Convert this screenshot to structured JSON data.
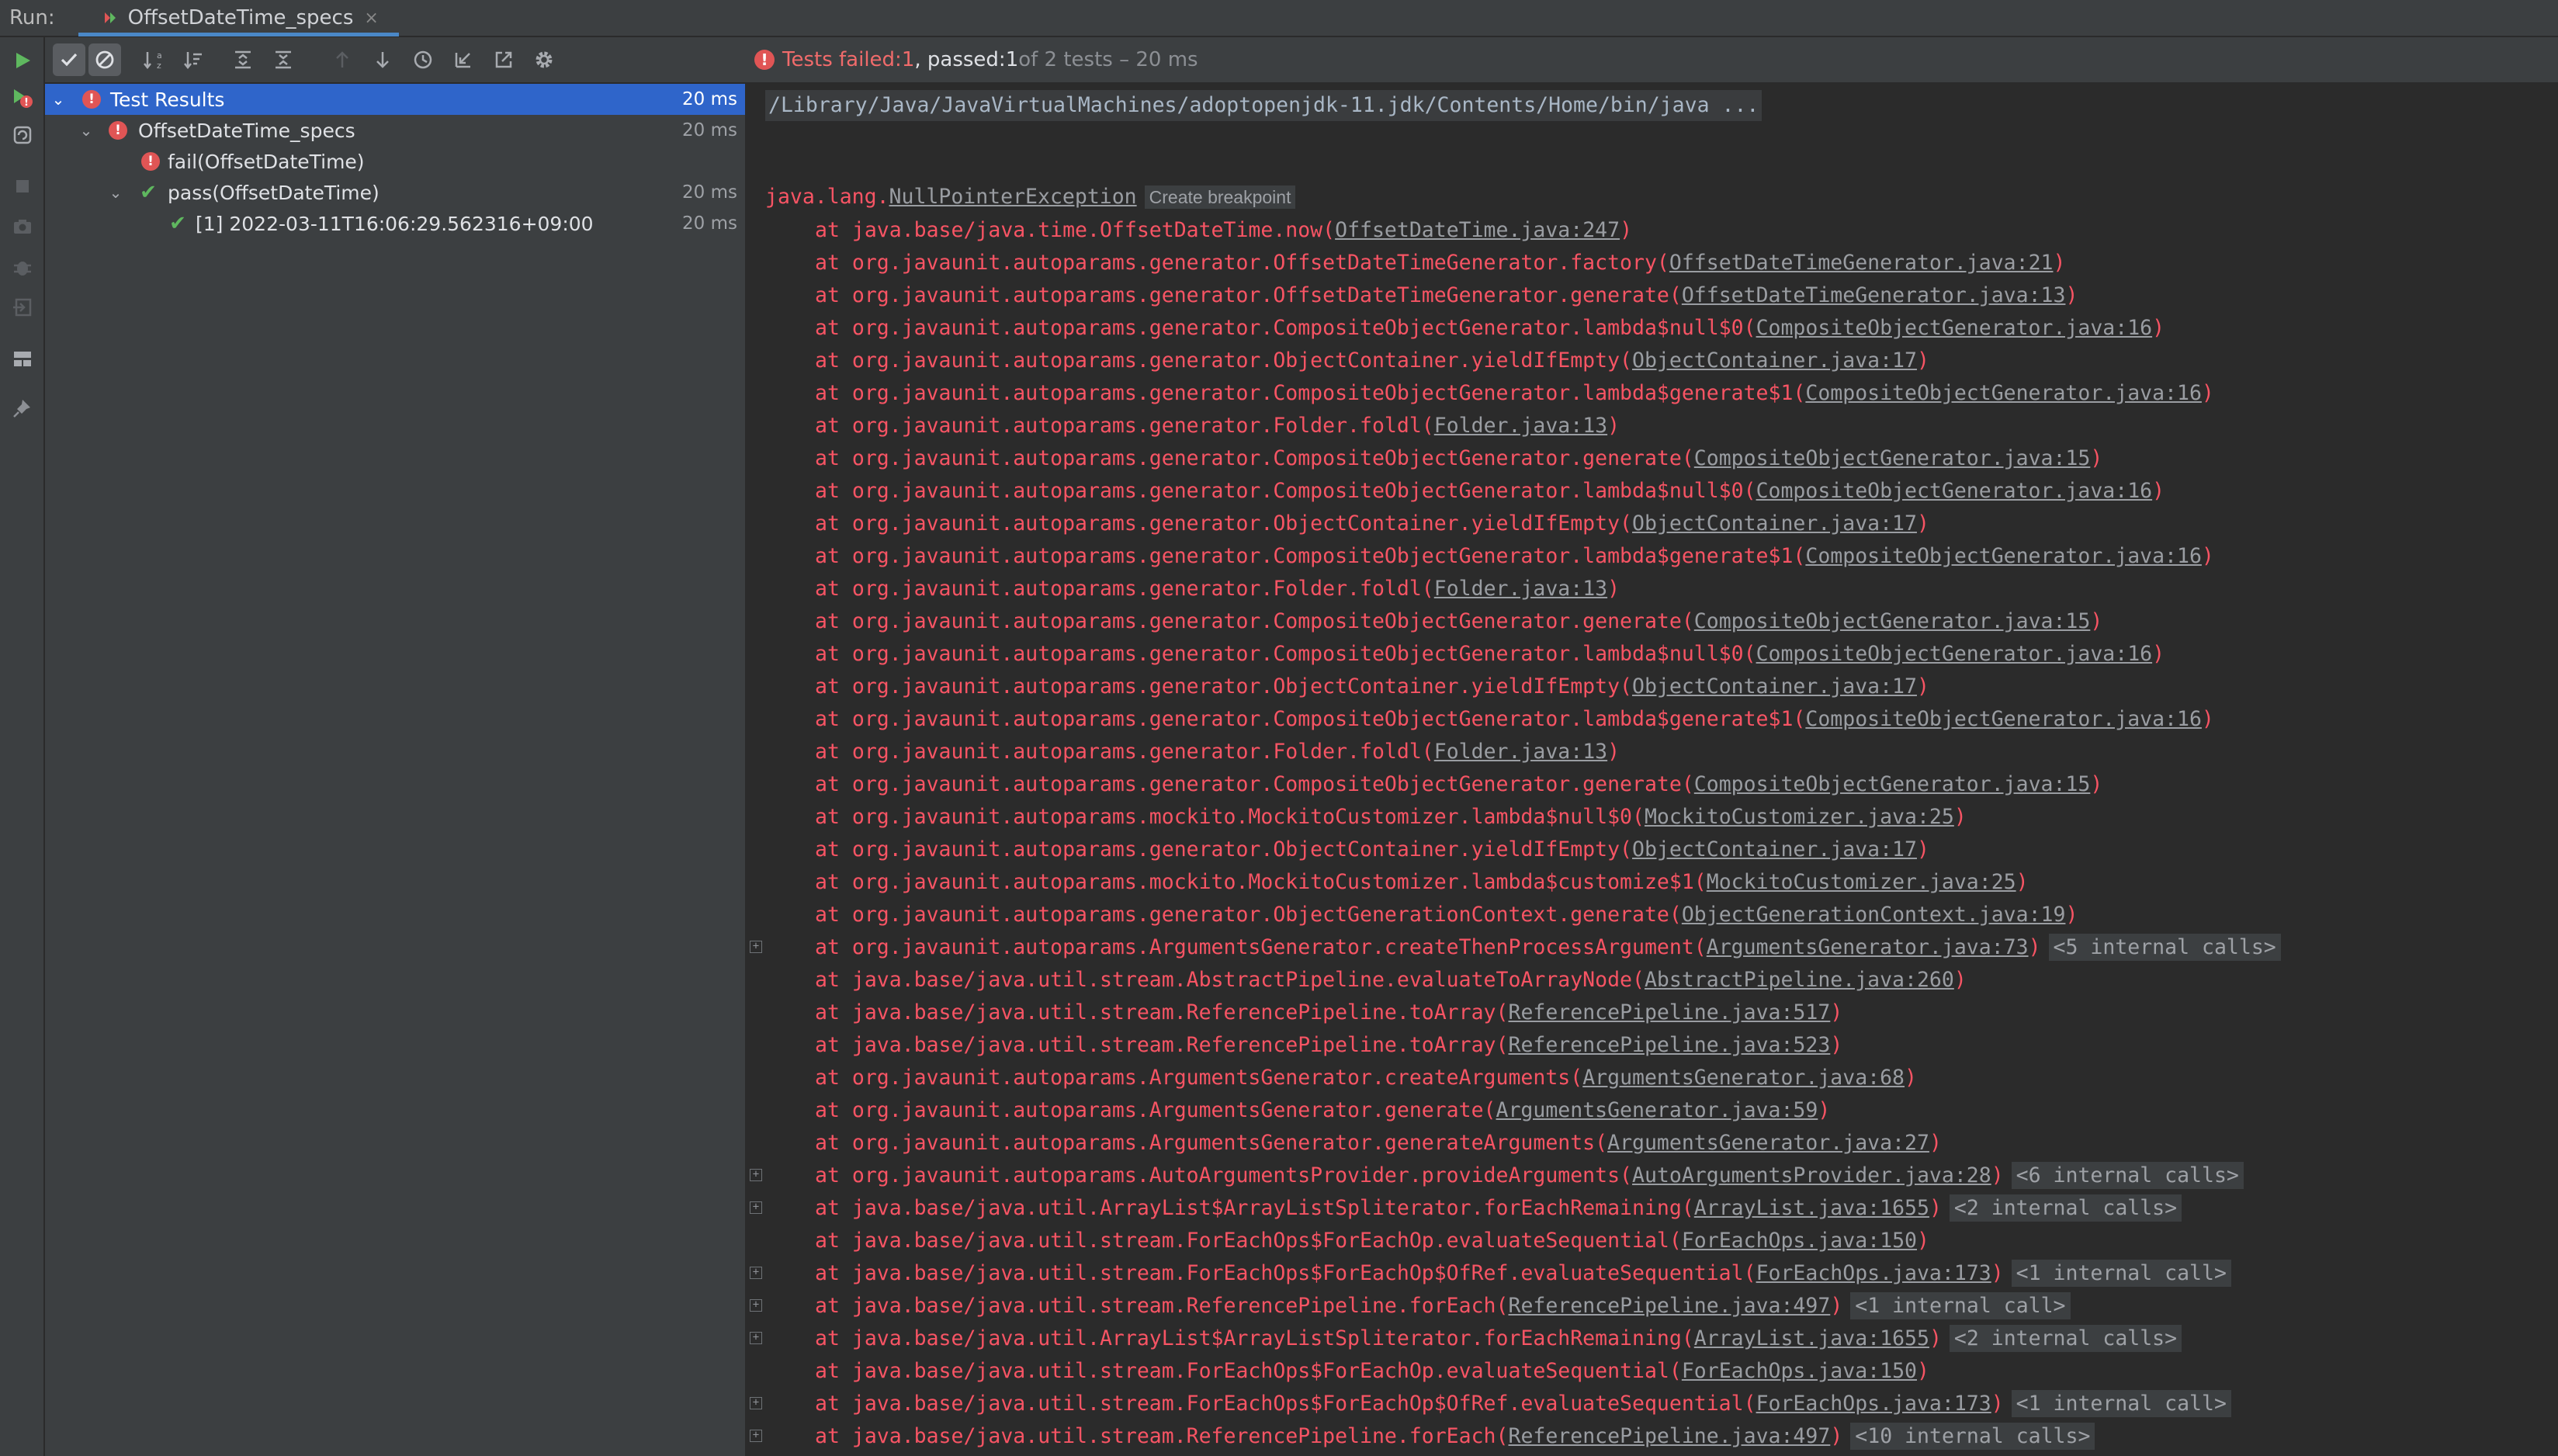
{
  "tabbar": {
    "run_label": "Run:",
    "tab_title": "OffsetDateTime_specs",
    "close_glyph": "×"
  },
  "status": {
    "prefix": "Tests failed: ",
    "failed": "1",
    "middle": ", passed: ",
    "passed": "1",
    "suffix": " of 2 tests – 20 ms"
  },
  "tree": {
    "rows": [
      {
        "label": "Test Results",
        "duration": "20 ms",
        "status": "fail",
        "expanded": true,
        "selected": true
      },
      {
        "label": "OffsetDateTime_specs",
        "duration": "20 ms",
        "status": "fail",
        "expanded": true
      },
      {
        "label": "fail(OffsetDateTime)",
        "duration": "",
        "status": "fail"
      },
      {
        "label": "pass(OffsetDateTime)",
        "duration": "20 ms",
        "status": "pass",
        "expanded": true
      },
      {
        "label": "[1] 2022-03-11T16:06:29.562316+09:00",
        "duration": "20 ms",
        "status": "pass"
      }
    ]
  },
  "console": {
    "command": "/Library/Java/JavaVirtualMachines/adoptopenjdk-11.jdk/Contents/Home/bin/java ...",
    "exception_pkg": "java.lang.",
    "exception_name": "NullPointerException",
    "create_breakpoint": "Create breakpoint",
    "frames": [
      {
        "method": "java.base/java.time.OffsetDateTime.now",
        "loc": "OffsetDateTime.java:247"
      },
      {
        "method": "org.javaunit.autoparams.generator.OffsetDateTimeGenerator.factory",
        "loc": "OffsetDateTimeGenerator.java:21"
      },
      {
        "method": "org.javaunit.autoparams.generator.OffsetDateTimeGenerator.generate",
        "loc": "OffsetDateTimeGenerator.java:13"
      },
      {
        "method": "org.javaunit.autoparams.generator.CompositeObjectGenerator.lambda$null$0",
        "loc": "CompositeObjectGenerator.java:16"
      },
      {
        "method": "org.javaunit.autoparams.generator.ObjectContainer.yieldIfEmpty",
        "loc": "ObjectContainer.java:17"
      },
      {
        "method": "org.javaunit.autoparams.generator.CompositeObjectGenerator.lambda$generate$1",
        "loc": "CompositeObjectGenerator.java:16"
      },
      {
        "method": "org.javaunit.autoparams.generator.Folder.foldl",
        "loc": "Folder.java:13"
      },
      {
        "method": "org.javaunit.autoparams.generator.CompositeObjectGenerator.generate",
        "loc": "CompositeObjectGenerator.java:15"
      },
      {
        "method": "org.javaunit.autoparams.generator.CompositeObjectGenerator.lambda$null$0",
        "loc": "CompositeObjectGenerator.java:16"
      },
      {
        "method": "org.javaunit.autoparams.generator.ObjectContainer.yieldIfEmpty",
        "loc": "ObjectContainer.java:17"
      },
      {
        "method": "org.javaunit.autoparams.generator.CompositeObjectGenerator.lambda$generate$1",
        "loc": "CompositeObjectGenerator.java:16"
      },
      {
        "method": "org.javaunit.autoparams.generator.Folder.foldl",
        "loc": "Folder.java:13"
      },
      {
        "method": "org.javaunit.autoparams.generator.CompositeObjectGenerator.generate",
        "loc": "CompositeObjectGenerator.java:15"
      },
      {
        "method": "org.javaunit.autoparams.generator.CompositeObjectGenerator.lambda$null$0",
        "loc": "CompositeObjectGenerator.java:16"
      },
      {
        "method": "org.javaunit.autoparams.generator.ObjectContainer.yieldIfEmpty",
        "loc": "ObjectContainer.java:17"
      },
      {
        "method": "org.javaunit.autoparams.generator.CompositeObjectGenerator.lambda$generate$1",
        "loc": "CompositeObjectGenerator.java:16"
      },
      {
        "method": "org.javaunit.autoparams.generator.Folder.foldl",
        "loc": "Folder.java:13"
      },
      {
        "method": "org.javaunit.autoparams.generator.CompositeObjectGenerator.generate",
        "loc": "CompositeObjectGenerator.java:15"
      },
      {
        "method": "org.javaunit.autoparams.mockito.MockitoCustomizer.lambda$null$0",
        "loc": "MockitoCustomizer.java:25"
      },
      {
        "method": "org.javaunit.autoparams.generator.ObjectContainer.yieldIfEmpty",
        "loc": "ObjectContainer.java:17"
      },
      {
        "method": "org.javaunit.autoparams.mockito.MockitoCustomizer.lambda$customize$1",
        "loc": "MockitoCustomizer.java:25"
      },
      {
        "method": "org.javaunit.autoparams.generator.ObjectGenerationContext.generate",
        "loc": "ObjectGenerationContext.java:19"
      },
      {
        "method": "org.javaunit.autoparams.ArgumentsGenerator.createThenProcessArgument",
        "loc": "ArgumentsGenerator.java:73",
        "internal": "<5 internal calls>",
        "fold": true
      },
      {
        "method": "java.base/java.util.stream.AbstractPipeline.evaluateToArrayNode",
        "loc": "AbstractPipeline.java:260"
      },
      {
        "method": "java.base/java.util.stream.ReferencePipeline.toArray",
        "loc": "ReferencePipeline.java:517"
      },
      {
        "method": "java.base/java.util.stream.ReferencePipeline.toArray",
        "loc": "ReferencePipeline.java:523"
      },
      {
        "method": "org.javaunit.autoparams.ArgumentsGenerator.createArguments",
        "loc": "ArgumentsGenerator.java:68"
      },
      {
        "method": "org.javaunit.autoparams.ArgumentsGenerator.generate",
        "loc": "ArgumentsGenerator.java:59"
      },
      {
        "method": "org.javaunit.autoparams.ArgumentsGenerator.generateArguments",
        "loc": "ArgumentsGenerator.java:27"
      },
      {
        "method": "org.javaunit.autoparams.AutoArgumentsProvider.provideArguments",
        "loc": "AutoArgumentsProvider.java:28",
        "internal": "<6 internal calls>",
        "fold": true
      },
      {
        "method": "java.base/java.util.ArrayList$ArrayListSpliterator.forEachRemaining",
        "loc": "ArrayList.java:1655",
        "internal": "<2 internal calls>",
        "fold": true
      },
      {
        "method": "java.base/java.util.stream.ForEachOps$ForEachOp.evaluateSequential",
        "loc": "ForEachOps.java:150"
      },
      {
        "method": "java.base/java.util.stream.ForEachOps$ForEachOp$OfRef.evaluateSequential",
        "loc": "ForEachOps.java:173",
        "internal": "<1 internal call>",
        "fold": true
      },
      {
        "method": "java.base/java.util.stream.ReferencePipeline.forEach",
        "loc": "ReferencePipeline.java:497",
        "internal": "<1 internal call>",
        "fold": true
      },
      {
        "method": "java.base/java.util.ArrayList$ArrayListSpliterator.forEachRemaining",
        "loc": "ArrayList.java:1655",
        "internal": "<2 internal calls>",
        "fold": true
      },
      {
        "method": "java.base/java.util.stream.ForEachOps$ForEachOp.evaluateSequential",
        "loc": "ForEachOps.java:150"
      },
      {
        "method": "java.base/java.util.stream.ForEachOps$ForEachOp$OfRef.evaluateSequential",
        "loc": "ForEachOps.java:173",
        "internal": "<1 internal call>",
        "fold": true
      },
      {
        "method": "java.base/java.util.stream.ReferencePipeline.forEach",
        "loc": "ReferencePipeline.java:497",
        "internal": "<10 internal calls>",
        "fold": true
      }
    ]
  },
  "colors": {
    "error_red": "#f75464",
    "pass_green": "#5fb85f",
    "selection_blue": "#2f65ca",
    "tab_underline": "#4a88c7"
  },
  "icons": {
    "left_toolbar": [
      "rerun-icon",
      "rerun-failed-icon",
      "toggle-auto-test-icon",
      "stop-icon",
      "camera-icon",
      "debug-icon",
      "exit-icon",
      "layout-icon",
      "pin-icon"
    ],
    "toolbar": [
      "show-passed-icon",
      "show-ignored-icon",
      "sort-alphabetically-icon",
      "sort-by-duration-icon",
      "expand-all-icon",
      "collapse-all-icon",
      "previous-failed-icon",
      "next-failed-icon",
      "history-icon",
      "import-tests-icon",
      "export-tests-icon",
      "settings-icon"
    ]
  }
}
